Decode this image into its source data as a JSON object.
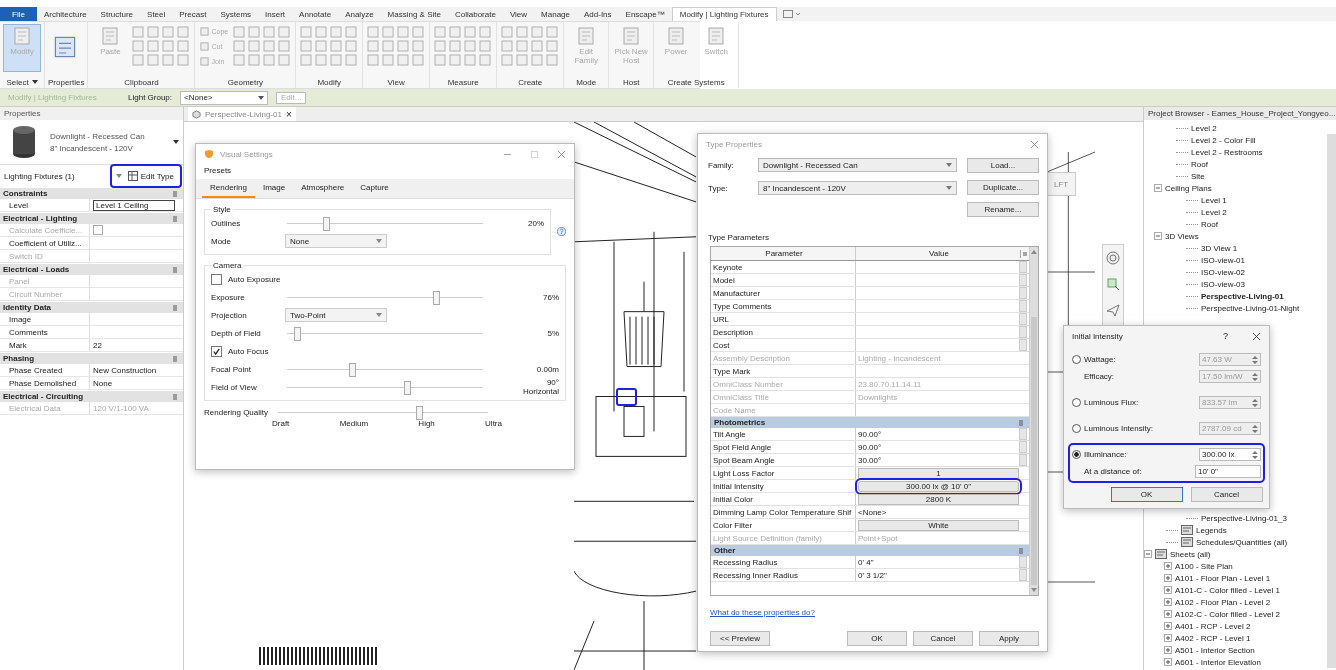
{
  "ribbon": {
    "tabs": [
      {
        "label": "File",
        "kind": "file",
        "selected": false
      },
      {
        "label": "Architecture",
        "kind": "tab",
        "selected": false
      },
      {
        "label": "Structure",
        "kind": "tab",
        "selected": false
      },
      {
        "label": "Steel",
        "kind": "tab",
        "selected": false
      },
      {
        "label": "Precast",
        "kind": "tab",
        "selected": false
      },
      {
        "label": "Systems",
        "kind": "tab",
        "selected": false
      },
      {
        "label": "Insert",
        "kind": "tab",
        "selected": false
      },
      {
        "label": "Annotate",
        "kind": "tab",
        "selected": false
      },
      {
        "label": "Analyze",
        "kind": "tab",
        "selected": false
      },
      {
        "label": "Massing & Site",
        "kind": "tab",
        "selected": false
      },
      {
        "label": "Collaborate",
        "kind": "tab",
        "selected": false
      },
      {
        "label": "View",
        "kind": "tab",
        "selected": false
      },
      {
        "label": "Manage",
        "kind": "tab",
        "selected": false
      },
      {
        "label": "Add-Ins",
        "kind": "tab",
        "selected": false
      },
      {
        "label": "Enscape™",
        "kind": "tab",
        "selected": false
      },
      {
        "label": "Modify | Lighting Fixtures",
        "kind": "tab",
        "selected": true
      }
    ],
    "groups": [
      {
        "label": "Select",
        "dropdown": true,
        "icon_grid": false,
        "tools": [
          {
            "label": "Modify",
            "kind": "large",
            "selected": true
          }
        ]
      },
      {
        "label": "Properties",
        "dropdown": false,
        "icon_grid": false,
        "tools": [
          {
            "kind": "properties",
            "selected": false
          }
        ]
      },
      {
        "label": "Clipboard",
        "dropdown": false,
        "icon_grid": true,
        "tools": [
          {
            "label": "Paste",
            "kind": "large",
            "selected": false
          }
        ]
      },
      {
        "label": "Geometry",
        "dropdown": false,
        "icon_grid": true,
        "tools": [
          {
            "label": "Cope",
            "kind": "small",
            "selected": false
          },
          {
            "label": "Cut",
            "kind": "small",
            "selected": false
          },
          {
            "label": "Join",
            "kind": "small",
            "selected": false
          }
        ]
      },
      {
        "label": "Modify",
        "dropdown": false,
        "icon_grid": true
      },
      {
        "label": "View",
        "dropdown": false,
        "icon_grid": true
      },
      {
        "label": "Measure",
        "dropdown": false,
        "icon_grid": true
      },
      {
        "label": "Create",
        "dropdown": false,
        "icon_grid": true
      },
      {
        "label": "Mode",
        "dropdown": false,
        "icon_grid": false,
        "tools": [
          {
            "label": "Edit Family",
            "kind": "large",
            "selected": false
          }
        ]
      },
      {
        "label": "Host",
        "dropdown": false,
        "icon_grid": false,
        "tools": [
          {
            "label": "Pick New Host",
            "kind": "large",
            "selected": false
          }
        ]
      },
      {
        "label": "Create Systems",
        "dropdown": false,
        "icon_grid": false,
        "tools": [
          {
            "label": "Power",
            "kind": "large",
            "selected": false
          },
          {
            "label": "Switch",
            "kind": "large",
            "selected": false
          }
        ]
      }
    ]
  },
  "context_bar": {
    "title": "Modify | Lighting Fixtures",
    "light_group_label": "Light Group:",
    "light_group_value": "<None>",
    "edit_button": "Edit...",
    "edit_disabled": true
  },
  "properties": {
    "title": "Properties",
    "family": "Downlight - Recessed Can",
    "type": "8\" Incandescent - 120V",
    "filter": "Lighting Fixtures (1)",
    "edit_type": {
      "label": "Edit Type",
      "highlighted": true
    },
    "groups": [
      {
        "title": "Constraints",
        "rows": [
          {
            "label": "Level",
            "value": "Level 1 Ceiling",
            "kind": "field",
            "disabled": false
          }
        ]
      },
      {
        "title": "Electrical - Lighting",
        "rows": [
          {
            "label": "Calculate Coefficie...",
            "kind": "checkbox",
            "checked": false,
            "disabled": true
          },
          {
            "label": "Coefficient of Utiliz...",
            "value": "",
            "kind": "text",
            "disabled": false
          },
          {
            "label": "Switch ID",
            "value": "",
            "kind": "text",
            "disabled": true
          }
        ]
      },
      {
        "title": "Electrical - Loads",
        "rows": [
          {
            "label": "Panel",
            "value": "",
            "kind": "text",
            "disabled": true
          },
          {
            "label": "Circuit Number",
            "value": "",
            "kind": "text",
            "disabled": true
          }
        ]
      },
      {
        "title": "Identity Data",
        "rows": [
          {
            "label": "Image",
            "value": "",
            "kind": "text",
            "disabled": false
          },
          {
            "label": "Comments",
            "value": "",
            "kind": "text",
            "disabled": false
          },
          {
            "label": "Mark",
            "value": "22",
            "kind": "text",
            "disabled": false
          }
        ]
      },
      {
        "title": "Phasing",
        "rows": [
          {
            "label": "Phase Created",
            "value": "New Construction",
            "kind": "text",
            "disabled": false
          },
          {
            "label": "Phase Demolished",
            "value": "None",
            "kind": "text",
            "disabled": false
          }
        ]
      },
      {
        "title": "Electrical - Circuiting",
        "rows": [
          {
            "label": "Electrical Data",
            "value": "120 V/1-100 VA",
            "kind": "text",
            "disabled": true
          }
        ]
      }
    ]
  },
  "view_tab": {
    "label": "Perspective-Living-01",
    "close": "×"
  },
  "viewport": {
    "view_cube": "LFT",
    "fixture_highlighted": true
  },
  "visual_settings": {
    "title": "Visual Settings",
    "menu": "Presets",
    "tabs": [
      {
        "label": "Rendering",
        "selected": true
      },
      {
        "label": "Image",
        "selected": false
      },
      {
        "label": "Atmosphere",
        "selected": false
      },
      {
        "label": "Capture",
        "selected": false
      }
    ],
    "sections": [
      {
        "title": "Style",
        "rows": [
          {
            "kind": "slider",
            "label": "Outlines",
            "level": 0.2,
            "reading": "20%"
          },
          {
            "kind": "select",
            "label": "Mode",
            "value": "None"
          }
        ]
      },
      {
        "title": "Camera",
        "rows": [
          {
            "kind": "checkbox",
            "label": "Auto Exposure",
            "checked": false
          },
          {
            "kind": "slider",
            "label": "Exposure",
            "level": 0.76,
            "reading": "76%"
          },
          {
            "kind": "select",
            "label": "Projection",
            "value": "Two-Point"
          },
          {
            "kind": "slider",
            "label": "Depth of Field",
            "level": 0.05,
            "reading": "5%"
          },
          {
            "kind": "checkbox",
            "label": "Auto Focus",
            "checked": true
          },
          {
            "kind": "slider",
            "label": "Focal Point",
            "level": 0.33,
            "reading": "0.00m"
          },
          {
            "kind": "slider",
            "label": "Field of View",
            "level": 0.61,
            "reading": "90°",
            "sub_reading": "Horizontal"
          }
        ]
      }
    ],
    "quality": {
      "label": "Rendering Quality",
      "level": 0.67,
      "ticks": [
        "Draft",
        "Medium",
        "High",
        "Ultra"
      ]
    }
  },
  "type_properties": {
    "title": "Type Properties",
    "family_label": "Family:",
    "family": "Downlight - Recessed Can",
    "type_label": "Type:",
    "type": "8\" Incandescent - 120V",
    "buttons": [
      "Load...",
      "Duplicate...",
      "Rename..."
    ],
    "section": "Type Parameters",
    "columns": [
      "Parameter",
      "Value"
    ],
    "groups": [
      {
        "rows": [
          {
            "label": "Keynote",
            "value": "",
            "kind": "param",
            "disabled": false
          },
          {
            "label": "Model",
            "value": "",
            "kind": "param",
            "disabled": false
          },
          {
            "label": "Manufacturer",
            "value": "",
            "kind": "param",
            "disabled": false
          },
          {
            "label": "Type Comments",
            "value": "",
            "kind": "param",
            "disabled": false
          },
          {
            "label": "URL",
            "value": "",
            "kind": "param",
            "disabled": false
          },
          {
            "label": "Description",
            "value": "",
            "kind": "param",
            "disabled": false
          },
          {
            "label": "Cost",
            "value": "",
            "kind": "param",
            "disabled": false
          },
          {
            "label": "Assembly Description",
            "value": "Lighting - Incandescent",
            "kind": "text",
            "disabled": true
          },
          {
            "label": "Type Mark",
            "value": "",
            "kind": "text",
            "disabled": false
          },
          {
            "label": "OmniClass Number",
            "value": "23.80.70.11.14.11",
            "kind": "text",
            "disabled": true
          },
          {
            "label": "OmniClass Title",
            "value": "Downlights",
            "kind": "text",
            "disabled": true
          },
          {
            "label": "Code Name",
            "value": "",
            "kind": "text",
            "disabled": true
          }
        ]
      },
      {
        "title": "Photometrics",
        "rows": [
          {
            "label": "Tilt Angle",
            "value": "90.00°",
            "kind": "param",
            "disabled": false
          },
          {
            "label": "Spot Field Angle",
            "value": "90.00°",
            "kind": "param",
            "disabled": false
          },
          {
            "label": "Spot Beam Angle",
            "value": "30.00°",
            "kind": "param",
            "disabled": false
          },
          {
            "label": "Light Loss Factor",
            "value": "1",
            "kind": "button",
            "disabled": false
          },
          {
            "label": "Initial Intensity",
            "value": "300.00 lx @ 10' 0\"",
            "kind": "button",
            "disabled": false,
            "highlighted": true
          },
          {
            "label": "Initial Color",
            "value": "2800 K",
            "kind": "button",
            "disabled": false
          },
          {
            "label": "Dimming Lamp Color Temperature Shif",
            "value": "<None>",
            "kind": "text",
            "disabled": false
          },
          {
            "label": "Color Filter",
            "value": "White",
            "kind": "button",
            "disabled": false
          },
          {
            "label": "Light Source Definition (family)",
            "value": "Point+Spot",
            "kind": "text",
            "disabled": true
          }
        ]
      },
      {
        "title": "Other",
        "rows": [
          {
            "label": "Recessing Radius",
            "value": "0' 4\"",
            "kind": "param",
            "disabled": false
          },
          {
            "label": "Recessing Inner Radius",
            "value": "0' 3 1/2\"",
            "kind": "param",
            "disabled": false
          }
        ]
      }
    ],
    "help_link": "What do these properties do?",
    "preview": "<< Preview",
    "actions": [
      "OK",
      "Cancel",
      "Apply"
    ]
  },
  "initial_intensity": {
    "title": "Initial Intensity",
    "help": "?",
    "options": [
      {
        "label": "Wattage:",
        "value": "47.63 W",
        "selected": false,
        "sub": {
          "label": "Efficacy:",
          "value": "17.50 lm/W"
        }
      },
      {
        "label": "Luminous Flux:",
        "value": "833.57 lm",
        "selected": false
      },
      {
        "label": "Luminous Intensity:",
        "value": "2787.09 cd",
        "selected": false
      },
      {
        "label": "Illuminance:",
        "value": "300.00 lx",
        "selected": true,
        "highlighted": true,
        "sub": {
          "label": "At a distance of:",
          "value": "10' 0\""
        }
      }
    ],
    "actions": [
      "OK",
      "Cancel"
    ]
  },
  "project_browser": {
    "title": "Project Browser - Eames_House_Project_Yongyeo...",
    "tree": [
      {
        "label": "Level 2"
      },
      {
        "label": "Level 2 - Color Fill"
      },
      {
        "label": "Level 2 - Restrooms"
      },
      {
        "label": "Roof"
      },
      {
        "label": "Site"
      },
      {
        "label": "Ceiling Plans",
        "expanded": true,
        "children": [
          {
            "label": "Level 1"
          },
          {
            "label": "Level 2"
          },
          {
            "label": "Roof"
          }
        ]
      },
      {
        "label": "3D Views",
        "expanded": true,
        "children": [
          {
            "label": "3D View 1",
            "selected": false
          },
          {
            "label": "ISO-view-01",
            "selected": false
          },
          {
            "label": "ISO-view-02",
            "selected": false
          },
          {
            "label": "ISO-view-03",
            "selected": false
          },
          {
            "label": "Perspective-Living-01",
            "selected": true
          },
          {
            "label": "Perspective-Living-01-Night",
            "selected": false
          },
          {
            "label": "Perspective-Living-01_3",
            "selected": false,
            "kind": "below-dialog"
          }
        ]
      },
      {
        "label": "Legends",
        "icon": true
      },
      {
        "label": "Schedules/Quantities (all)",
        "icon": true
      },
      {
        "label": "Sheets (all)",
        "expanded": true,
        "icon": true,
        "children": [
          {
            "label": "A100 - Site Plan",
            "expanded": false
          },
          {
            "label": "A101 - Floor Plan - Level 1",
            "expanded": false
          },
          {
            "label": "A101-C - Color filled - Level 1",
            "expanded": false
          },
          {
            "label": "A102 - Floor Plan - Level 2",
            "expanded": false
          },
          {
            "label": "A102-C - Color filled - Level 2",
            "expanded": false
          },
          {
            "label": "A401 - RCP - Level 2",
            "expanded": false
          },
          {
            "label": "A402 - RCP - Level 1",
            "expanded": false
          },
          {
            "label": "A501 - Interior Section",
            "expanded": false
          },
          {
            "label": "A601 - Interior Elevation",
            "expanded": false
          }
        ]
      }
    ]
  }
}
